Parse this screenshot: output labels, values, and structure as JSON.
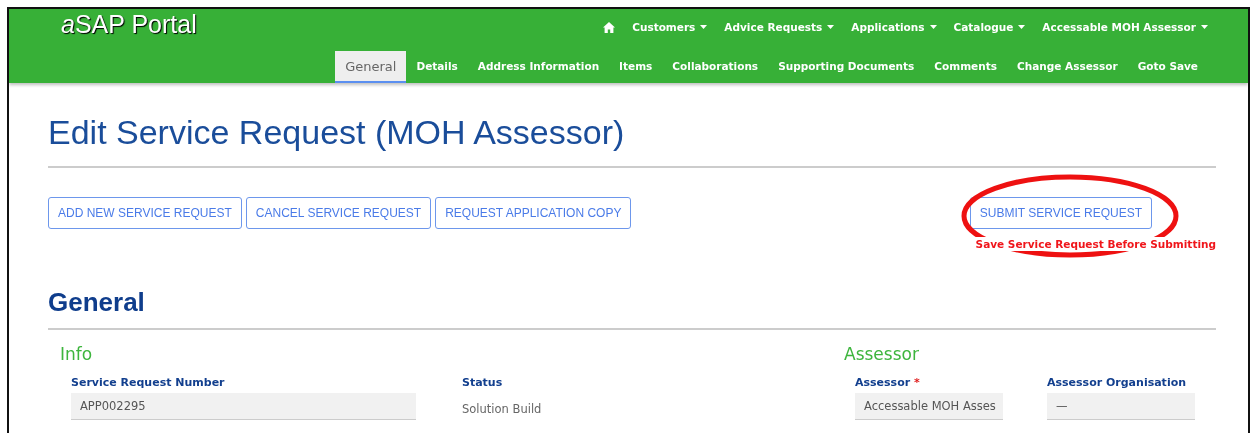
{
  "header": {
    "logo": {
      "italic_part": "a",
      "rest": "SAP Portal"
    },
    "nav": [
      {
        "kind": "home"
      },
      {
        "kind": "menu",
        "label": "Customers"
      },
      {
        "kind": "menu",
        "label": "Advice Requests"
      },
      {
        "kind": "menu",
        "label": "Applications"
      },
      {
        "kind": "menu",
        "label": "Catalogue"
      },
      {
        "kind": "menu",
        "label": "Accessable MOH Assessor"
      }
    ],
    "tabs": [
      {
        "label": "General",
        "selected": true
      },
      {
        "label": "Details",
        "selected": false
      },
      {
        "label": "Address Information",
        "selected": false
      },
      {
        "label": "Items",
        "selected": false
      },
      {
        "label": "Collaborations",
        "selected": false
      },
      {
        "label": "Supporting Documents",
        "selected": false
      },
      {
        "label": "Comments",
        "selected": false
      },
      {
        "label": "Change Assessor",
        "selected": false
      },
      {
        "label": "Goto Save",
        "selected": false
      }
    ]
  },
  "page_title": "Edit Service Request (MOH Assessor)",
  "actions": [
    "ADD NEW SERVICE REQUEST",
    "CANCEL SERVICE REQUEST",
    "REQUEST APPLICATION COPY"
  ],
  "submit": {
    "label": "SUBMIT SERVICE REQUEST",
    "warning": "Save Service Request Before Submitting",
    "highlighted": true
  },
  "section_title": "General",
  "groups": [
    {
      "title": "Info",
      "fields": [
        {
          "kind": "input",
          "label": "Service Request Number",
          "value": "APP002295"
        },
        {
          "kind": "text",
          "label": "Status",
          "value": "Solution Build"
        }
      ]
    },
    {
      "title": "Assessor",
      "fields": [
        {
          "kind": "input",
          "label": "Assessor",
          "required_mark": "*",
          "value": "Accessable MOH Asses"
        },
        {
          "kind": "input",
          "label": "Assessor Organisation",
          "value": "—"
        }
      ]
    }
  ]
}
